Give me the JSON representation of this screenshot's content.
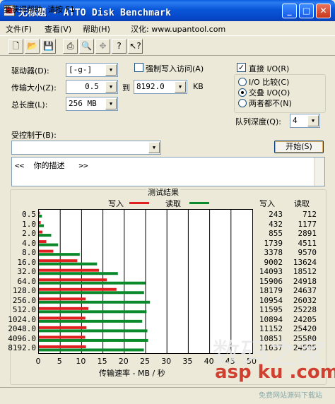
{
  "window": {
    "title": "无标题 - ATTO Disk Benchmark"
  },
  "menu": {
    "file": "文件(F)",
    "view": "查看(V)",
    "help": "帮助(H)",
    "credit": "汉化: www.upantool.com"
  },
  "toolbar": {
    "icons": [
      "new-icon",
      "open-icon",
      "save-icon",
      "print-icon",
      "print-preview-icon",
      "move-icon",
      "help-icon",
      "context-help-icon"
    ]
  },
  "controls": {
    "drive_label": "驱动器(D):",
    "drive_value": "[-g-]",
    "transfer_label": "传输大小(Z):",
    "transfer_from": "0.5",
    "transfer_to_label": "到",
    "transfer_to": "8192.0",
    "transfer_unit": "KB",
    "length_label": "总长度(L):",
    "length_value": "256 MB",
    "force_write_label": "强制写入访问(A)",
    "force_write_checked": false,
    "direct_io_label": "直接 I/O(R)",
    "direct_io_checked": true,
    "mode_options": [
      "I/O 比较(C)",
      "交叠 I/O(O)",
      "两者都不(N)"
    ],
    "mode_selected": 1,
    "queue_label": "队列深度(Q):",
    "queue_value": "4",
    "controlled_by_label": "受控制于(B):",
    "controlled_by_value": "",
    "start_button": "开始(S)",
    "description": "<<  你的描述   >>"
  },
  "results": {
    "caption": "测试结果",
    "legend_write": "写入",
    "legend_read": "读取",
    "col_write": "写入",
    "col_read": "读取",
    "xlabel": "传输速率 - MB / 秒"
  },
  "colors": {
    "write": "#e02020",
    "read": "#0a8a2a",
    "grid": "#3a3ae0"
  },
  "chart_data": {
    "type": "bar",
    "categories": [
      "0.5",
      "1.0",
      "2.0",
      "4.0",
      "8.0",
      "16.0",
      "32.0",
      "64.0",
      "128.0",
      "256.0",
      "512.0",
      "1024.0",
      "2048.0",
      "4096.0",
      "8192.0"
    ],
    "xlabel": "传输速率 - MB / 秒",
    "xlim": [
      0,
      50
    ],
    "xticks": [
      "0",
      "5",
      "10",
      "15",
      "20",
      "25",
      "30",
      "35",
      "40",
      "45",
      "50"
    ],
    "series": [
      {
        "name": "写入",
        "values": [
          243,
          432,
          855,
          1739,
          3378,
          9002,
          14093,
          15906,
          18179,
          10954,
          11595,
          10894,
          11152,
          10851,
          11037
        ]
      },
      {
        "name": "读取",
        "values": [
          712,
          1177,
          2891,
          4511,
          9570,
          13624,
          18512,
          24918,
          24637,
          26032,
          25228,
          24205,
          25420,
          25580,
          24595
        ]
      }
    ],
    "unit_scale": 1000
  },
  "status": {
    "text": "要获得帮助, 请按 F1"
  },
  "watermark": {
    "line1": "数码之家",
    "line2": "asp ku .com",
    "line3": "免费网站源码下载站"
  }
}
